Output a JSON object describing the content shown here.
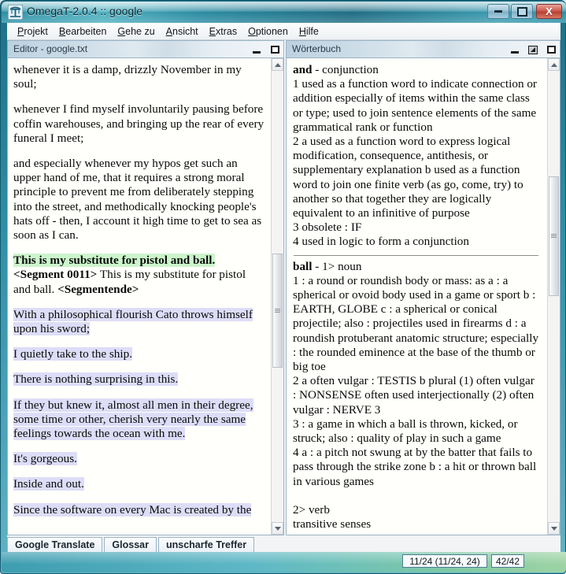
{
  "window": {
    "title": "OmegaT-2.0.4 :: google",
    "icon": "omegat-logo-icon",
    "controls": {
      "minimize": "minimize-icon",
      "maximize": "maximize-icon",
      "close": "X"
    }
  },
  "menubar": {
    "items": [
      {
        "mnemonic": "P",
        "rest": "rojekt"
      },
      {
        "mnemonic": "B",
        "rest": "earbeiten"
      },
      {
        "mnemonic": "G",
        "rest": "ehe zu"
      },
      {
        "mnemonic": "A",
        "rest": "nsicht"
      },
      {
        "mnemonic": "E",
        "rest": "xtras"
      },
      {
        "mnemonic": "O",
        "rest": "ptionen"
      },
      {
        "mnemonic": "H",
        "rest": "ilfe"
      }
    ]
  },
  "editor_panel": {
    "title": "Editor - google.txt",
    "header_buttons": [
      "minimize-icon",
      "maximize-icon"
    ],
    "paragraphs": [
      {
        "kind": "plain",
        "text": "whenever it is a damp, drizzly November in my soul;"
      },
      {
        "kind": "plain",
        "text": "whenever I find myself involuntarily pausing before coffin warehouses, and bringing up the rear of every funeral I meet;"
      },
      {
        "kind": "plain",
        "text": "and especially whenever my hypos get such an upper hand of me, that it requires a strong moral principle to prevent me from deliberately stepping into the street, and methodically knocking people's hats off - then, I account it high time to get to sea as soon as I can."
      },
      {
        "kind": "active-segment",
        "source": "This is my substitute for pistol and ball.",
        "marker_start": "<Segment 0011>",
        "target": "This is my substitute for pistol and ball.",
        "marker_end": "<Segmentende>"
      },
      {
        "kind": "translated",
        "text": "With a philosophical flourish Cato throws himself upon his sword;"
      },
      {
        "kind": "translated",
        "text": "I quietly take to the ship."
      },
      {
        "kind": "translated",
        "text": "There is nothing surprising in this."
      },
      {
        "kind": "translated",
        "text": "If they but knew it, almost all men in their degree, some time or other, cherish very nearly the same feelings towards the ocean with me."
      },
      {
        "kind": "translated",
        "text": "It's gorgeous."
      },
      {
        "kind": "translated",
        "text": "Inside and out."
      },
      {
        "kind": "translated-clipped",
        "text": "Since the software on every Mac is created by the"
      }
    ]
  },
  "dictionary_panel": {
    "title": "Wörterbuch",
    "header_buttons": [
      "minimize-icon",
      "undock-icon",
      "maximize-icon"
    ],
    "entries": [
      {
        "headword": "and",
        "pos": " - conjunction",
        "lines": [
          "1 used as a function word to indicate connection or addition especially of items within the same class or type; used to join sentence elements of the same grammatical rank or function",
          "2 a used as a function word to express logical modification, consequence, antithesis, or supplementary explanation b used as a function word to join one finite verb (as go, come, try) to another so that together they are logically equivalent to an infinitive of purpose",
          "3 obsolete : IF",
          "4 used in logic to form a conjunction"
        ]
      },
      {
        "headword": "ball",
        "pos": " - 1> noun",
        "lines": [
          "1 : a round or roundish body or mass: as a : a spherical or ovoid body used in a game or sport b : EARTH, GLOBE c : a spherical or conical projectile; also : projectiles used in firearms d : a roundish protuberant anatomic structure; especially : the rounded eminence at the base of the thumb or big toe",
          "2 a often vulgar : TESTIS b plural (1) often vulgar : NONSENSE often used interjectionally (2) often vulgar : NERVE 3",
          "3 : a game in which a ball is thrown, kicked, or struck; also : quality of play in such a game",
          "4 a : a pitch not swung at by the batter that fails to pass through the strike zone b : a hit or thrown ball in various games"
        ],
        "trailing": [
          "2> verb",
          "transitive senses"
        ]
      }
    ]
  },
  "tabs": [
    {
      "label": "Google Translate"
    },
    {
      "label": "Glossar"
    },
    {
      "label": "unscharfe Treffer"
    }
  ],
  "statusbar": {
    "left_text": "",
    "progress": "11/24 (11/24, 24)",
    "count": "42/42"
  },
  "colors": {
    "active_segment_highlight": "#ccf5cc",
    "translated_segment_highlight": "#ddddf8",
    "titlebar_accent": "#2b8fa4",
    "statusbar_accent": "#5fb8c6",
    "close_button": "#b8402f"
  }
}
